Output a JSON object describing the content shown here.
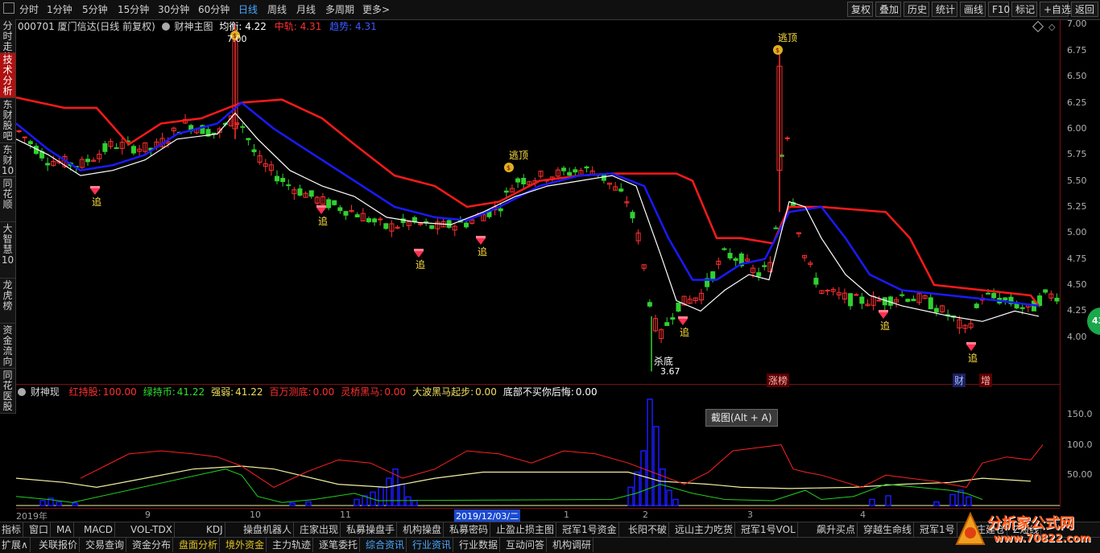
{
  "toolbar": {
    "left_items": [
      "分时",
      "1分钟",
      "5分钟",
      "15分钟",
      "30分钟",
      "60分钟",
      "日线",
      "周线",
      "月线",
      "多周期",
      "更多>"
    ],
    "active_period": "日线",
    "right_buttons": [
      "复权",
      "叠加",
      "历史",
      "统计",
      "画线",
      "F10",
      "标记",
      "+自选",
      "返回"
    ]
  },
  "left_tabs": [
    {
      "label": "分时走势",
      "active": false
    },
    {
      "label": "技术分析",
      "active": true
    },
    {
      "label": "东财股吧",
      "active": false
    },
    {
      "label": "东财10",
      "active": false
    },
    {
      "label": "同花顺",
      "active": false
    },
    {
      "label": "大智慧10",
      "active": false
    },
    {
      "label": "龙虎榜",
      "active": false
    },
    {
      "label": "资金流向",
      "active": false
    },
    {
      "label": "同花医股",
      "active": false
    }
  ],
  "main_info": {
    "stock": "000701 厦门信达(日线 前复权)",
    "indicator": "财神主图",
    "junheng_label": "均衡:",
    "junheng_value": "4.22",
    "zhonggui_label": "中轨:",
    "zhonggui_value": "4.31",
    "qushi_label": "趋势:",
    "qushi_value": "4.31"
  },
  "sub_info": {
    "indicator": "财神现",
    "items": [
      {
        "label": "红持股:",
        "value": "100.00",
        "color": "#ff3030"
      },
      {
        "label": "绿持币:",
        "value": "41.22",
        "color": "#30e030"
      },
      {
        "label": "强弱:",
        "value": "41.22",
        "color": "#f0e060"
      },
      {
        "label": "百万测底:",
        "value": "0.00",
        "color": "#ff3030"
      },
      {
        "label": "灵桥黑马:",
        "value": "0.00",
        "color": "#ff3030"
      },
      {
        "label": "大波黑马起步:",
        "value": "0.00",
        "color": "#f0e060"
      },
      {
        "label": "底部不买你后悔:",
        "value": "0.00",
        "color": "#ffffff"
      }
    ]
  },
  "price_axis": [
    "7.00",
    "6.75",
    "6.50",
    "6.25",
    "6.00",
    "5.75",
    "5.50",
    "5.25",
    "5.00",
    "4.75",
    "4.50",
    "4.25",
    "4.00"
  ],
  "sub_axis": [
    "150.0",
    "100.0",
    "50.00"
  ],
  "annotations": {
    "high_label": "7.00",
    "low_label": "3.67",
    "sell_top": "逃顶",
    "kill_bottom": "杀底",
    "chase": "追",
    "zhangbang": "涨榜",
    "cai": "财",
    "zeng": "增"
  },
  "colors": {
    "red_band": "#ff1a1a",
    "blue_band": "#1a1aff",
    "white_line": "#ffffff",
    "up_candle": "#ff3030",
    "down_candle": "#30d030",
    "sub_red": "#ff2020",
    "sub_green": "#20d020",
    "sub_yellow": "#f0f0a0",
    "sub_bars": "#1a1aff"
  },
  "date_axis": {
    "labels": [
      {
        "text": "2019年"
      },
      {
        "text": "9"
      },
      {
        "text": "10"
      },
      {
        "text": "11"
      },
      {
        "text": "2019/12/03/二",
        "current": true
      },
      {
        "text": "1"
      },
      {
        "text": "2"
      },
      {
        "text": "3"
      },
      {
        "text": "4"
      }
    ]
  },
  "tooltip": "截图(Alt + A)",
  "zoom_badge": "43",
  "bottom_row1": [
    "指标",
    "窗口",
    "MA",
    "MACD",
    "VOL-TDX",
    "KDJ",
    "操盘机器人",
    "庄家出现",
    "私募操盘手",
    "机构操盘",
    "私募密码",
    "止盈止损主图",
    "冠军1号资金",
    "长阳不破",
    "远山主力吃货",
    "冠军1号VOL",
    "飙升买点",
    "穿越生命线",
    "冠军1号",
    "跟庄建仓",
    "Z短线"
  ],
  "bottom_row2": [
    "扩展∧",
    "关联报价",
    "交易查询",
    "资金分布",
    "盘面分析",
    "境外资金",
    "主力轨迹",
    "逐笔委托",
    "综合资讯",
    "行业资讯",
    "行业数据",
    "互动问答",
    "机构调研"
  ],
  "bottom_row2_highlight": [
    "盘面分析",
    "境外资金",
    "综合资讯",
    "行业资讯"
  ],
  "watermark": {
    "title": "分析家公式网",
    "url": "www.70822.com"
  }
}
